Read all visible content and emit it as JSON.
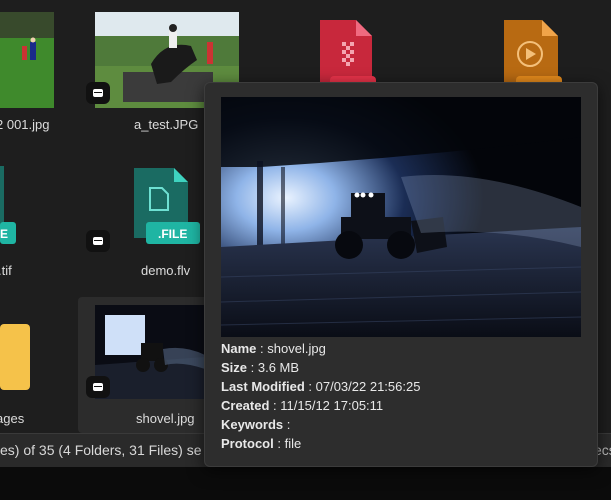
{
  "grid": {
    "items": [
      {
        "label": "2 001.jpg"
      },
      {
        "label": "a_test.JPG"
      },
      {
        "label": ".tif"
      },
      {
        "label": "demo.flv"
      },
      {
        "label": "ages"
      },
      {
        "label": "shovel.jpg"
      }
    ],
    "file_badge_text": ".FILE",
    "file_badge_text_left": "E"
  },
  "status": {
    "left_text": "es) of 35 (4 Folders, 31 Files) se",
    "right_text": "ecs"
  },
  "tooltip": {
    "name_label": "Name",
    "name_value": "shovel.jpg",
    "size_label": "Size",
    "size_value": "3.6 MB",
    "modified_label": "Last Modified",
    "modified_value": "07/03/22 21:56:25",
    "created_label": "Created",
    "created_value": "11/15/12 17:05:11",
    "keywords_label": "Keywords",
    "keywords_value": "",
    "protocol_label": "Protocol",
    "protocol_value": "file"
  },
  "colors": {
    "background": "#1e1e1e",
    "file_teal": "#1fb5a3",
    "pdf_red": "#c8283c",
    "media_orange": "#e48a1c",
    "folder_yellow": "#f5c24a"
  }
}
